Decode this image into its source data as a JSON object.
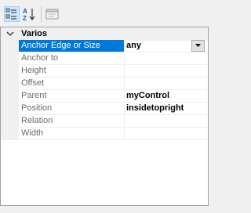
{
  "toolbar": {
    "buttons": [
      {
        "name": "categorized-view-button",
        "icon": "categorized-icon",
        "active": true
      },
      {
        "name": "alphabetical-sort-button",
        "icon": "sort-az-icon",
        "active": false
      },
      {
        "name": "property-pages-button",
        "icon": "property-pages-icon",
        "active": false,
        "disabled": true
      }
    ]
  },
  "grid": {
    "category": {
      "label": "Varios",
      "expanded": true,
      "toggle_icon": "chevron-down-icon"
    },
    "properties": [
      {
        "name": "Anchor Edge or Size",
        "value": "any",
        "selected": true,
        "has_dropdown": true
      },
      {
        "name": "Anchor to",
        "value": ""
      },
      {
        "name": "Height",
        "value": ""
      },
      {
        "name": "Offset",
        "value": ""
      },
      {
        "name": "Parent",
        "value": "myControl"
      },
      {
        "name": "Position",
        "value": "insidetopright"
      },
      {
        "name": "Relation",
        "value": ""
      },
      {
        "name": "Width",
        "value": ""
      }
    ]
  },
  "colors": {
    "selection": "#0078d7",
    "category_bg": "#f0f0f0",
    "grid_bg": "#ffffff"
  }
}
